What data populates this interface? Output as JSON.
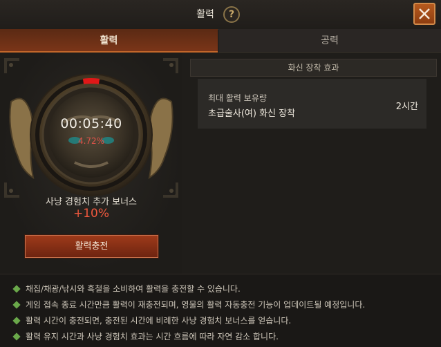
{
  "window": {
    "title": "활력",
    "help_symbol": "?"
  },
  "tabs": [
    {
      "label": "활력",
      "active": true
    },
    {
      "label": "공력",
      "active": false
    }
  ],
  "gauge": {
    "timer": "00:05:40",
    "percent_label": "4.72%",
    "fill_percent": 4.72,
    "bonus_label": "사냥 경험치 추가 보너스",
    "bonus_value": "+10%",
    "charge_button": "활력충전"
  },
  "effect_panel": {
    "header": "화신 장착 효과",
    "rows": [
      {
        "label": "최대 활력 보유량",
        "name": "초급술사(여) 화신 장착",
        "value": "2시간"
      }
    ]
  },
  "notes": [
    "채집/채광/낚시와 흑철을 소비하여 활력을 충전할 수 있습니다.",
    "게임 접속 종료 시간만큼 활력이 재충전되며, 영물의 활력 자동충전 기능이 업데이트될 예정입니다.",
    "활력 시간이 충전되면, 충전된 시간에 비례한 사냥 경험치 보너스를 얻습니다.",
    "활력 유지 시간과 사냥 경험치 효과는 시간 흐름에 따라 자연 감소 합니다."
  ],
  "colors": {
    "accent": "#c2662a",
    "bonus_red": "#f0583e",
    "gauge_red": "#e01818",
    "note_bullet": "#6aa84a"
  },
  "icons": [
    "help-icon",
    "close-icon",
    "bullet-icon",
    "demon-face-emblem"
  ]
}
